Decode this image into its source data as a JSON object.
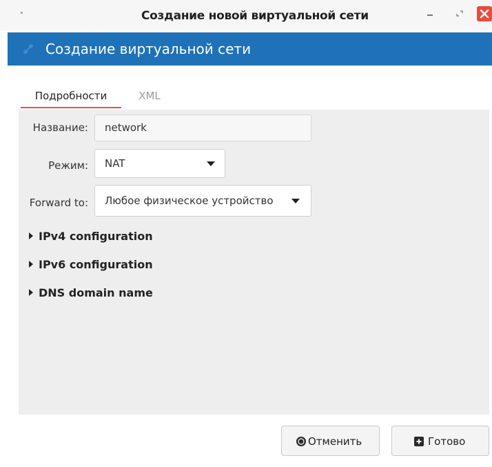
{
  "window": {
    "title": "Создание новой виртуальной сети",
    "close_color": "#e74c3c"
  },
  "banner": {
    "title": "Создание виртуальной сети",
    "icon": "network-icon",
    "color": "#1f72b8"
  },
  "tabs": [
    {
      "label": "Подробности",
      "active": true
    },
    {
      "label": "XML",
      "active": false
    }
  ],
  "form": {
    "name": {
      "label": "Название:",
      "value": "network"
    },
    "mode": {
      "label": "Режим:",
      "value": "NAT"
    },
    "forward": {
      "label": "Forward to:",
      "value": "Любое физическое устройство"
    }
  },
  "expanders": [
    {
      "label": "IPv4 configuration"
    },
    {
      "label": "IPv6 configuration"
    },
    {
      "label": "DNS domain name"
    }
  ],
  "buttons": {
    "cancel": {
      "label": "Отменить",
      "icon": "stop-circle-icon"
    },
    "finish": {
      "label": "Готово",
      "icon": "add-box-icon"
    }
  }
}
